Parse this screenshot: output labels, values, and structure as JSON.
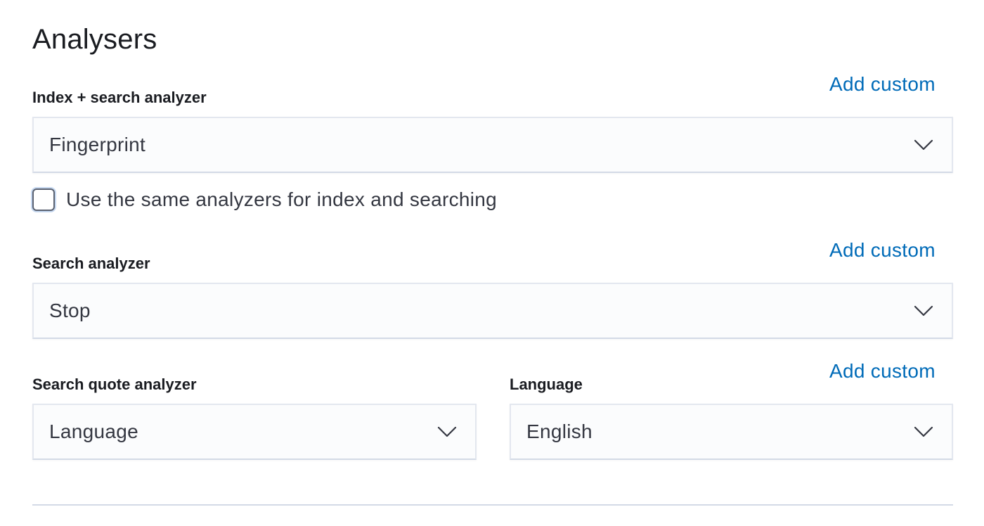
{
  "section": {
    "title": "Analysers"
  },
  "index_search": {
    "label": "Index + search analyzer",
    "add_custom": "Add custom",
    "value": "Fingerprint"
  },
  "same_analyzers": {
    "label": "Use the same analyzers for index and searching",
    "checked": false
  },
  "search": {
    "label": "Search analyzer",
    "add_custom": "Add custom",
    "value": "Stop"
  },
  "search_quote": {
    "label": "Search quote analyzer",
    "value": "Language"
  },
  "language": {
    "label": "Language",
    "add_custom": "Add custom",
    "value": "English"
  },
  "colors": {
    "link": "#006bb8",
    "text": "#1a1c21",
    "field_bg": "#fbfcfd",
    "border": "#d3dae6"
  },
  "icons": {
    "select_chevron": "chevron-down-icon"
  }
}
